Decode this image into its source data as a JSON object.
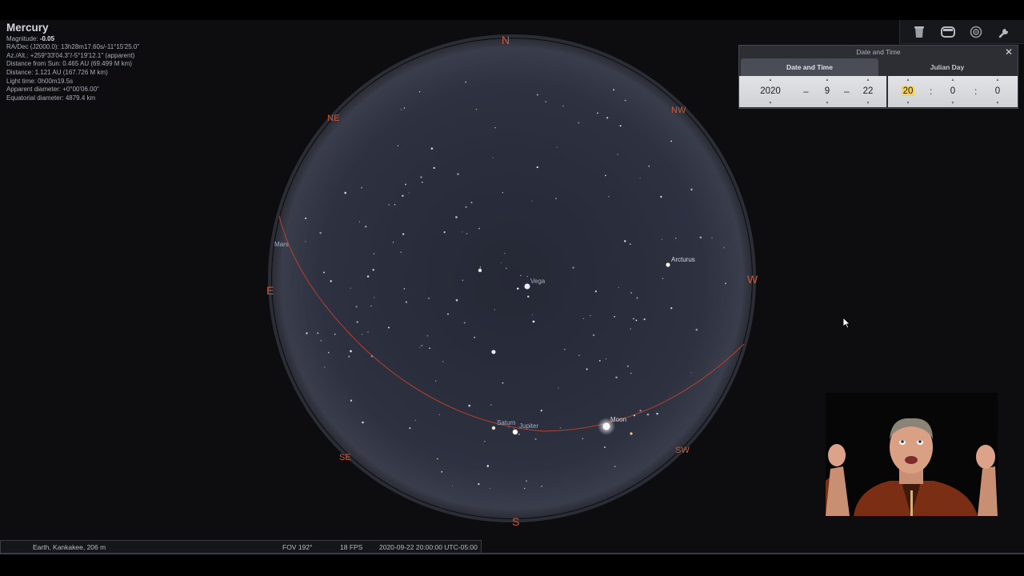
{
  "info": {
    "title": "Mercury",
    "magnitude_label": "Magnitude: ",
    "magnitude_value": "-0.05",
    "radec": "RA/Dec (J2000.0): 13h28m17.60s/-11°15'25.0\"",
    "azalt": "Az./Alt.: +259°33'04.3\"/-5°19'12.1\" (apparent)",
    "dist_sun": "Distance from Sun: 0.465 AU (69.499 M km)",
    "distance": "Distance: 1.121 AU (167.726 M km)",
    "light_time": "Light time: 0h00m19.5s",
    "app_diam": "Apparent diameter: +0°00'06.00\"",
    "eq_diam": "Equatorial diameter: 4879.4 km"
  },
  "compass": {
    "n": "N",
    "ne": "NE",
    "nw": "NW",
    "e": "E",
    "w": "W",
    "se": "SE",
    "sw": "SW",
    "s": "S"
  },
  "labels": {
    "mars": "Mars",
    "vega": "Vega",
    "arcturus": "Arcturus",
    "saturn": "Saturn",
    "jupiter": "Jupiter",
    "moon": "Moon"
  },
  "toolbar": {
    "icons": [
      "bucket-icon",
      "window-icon",
      "satellite-icon",
      "wrench-icon"
    ]
  },
  "datetime_window": {
    "title": "Date and Time",
    "close_icon": "✕",
    "tabs": [
      "Date and Time",
      "Julian Day"
    ],
    "year": "2020",
    "month": "9",
    "day": "22",
    "hour": "20",
    "minute": "0",
    "second": "0",
    "date_sep": "–",
    "time_sep": ":"
  },
  "status": {
    "location": "Earth, Kankakee, 206 m",
    "fov": "FOV 192°",
    "fps": "18 FPS",
    "datetime": "2020-09-22 20:00:00 UTC-05:00"
  },
  "colors": {
    "sky": "#2d3140",
    "compass": "#cc5a36",
    "ecliptic": "#b8402c",
    "star": "#f2f4f8"
  }
}
